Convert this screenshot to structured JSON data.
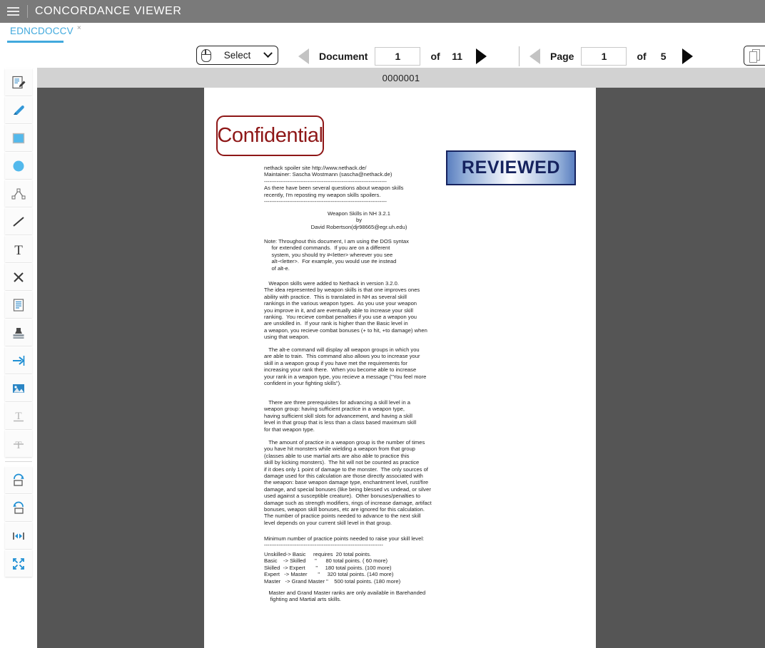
{
  "header": {
    "title": "CONCORDANCE VIEWER",
    "menu_icon": "hamburger-icon"
  },
  "tabs": [
    {
      "label": "EDNCDOCCV",
      "close": "×",
      "active": true
    }
  ],
  "toolbar": {
    "select_tool": {
      "label": "Select",
      "icon": "mouse-icon",
      "chevron": "chevron-down-icon"
    },
    "document_nav": {
      "label": "Document",
      "value": "1",
      "of": "of",
      "total": "11",
      "prev_icon": "triangle-left-icon",
      "next_icon": "triangle-right-icon"
    },
    "page_nav": {
      "label": "Page",
      "value": "1",
      "of": "of",
      "total": "5",
      "prev_icon": "triangle-left-icon",
      "next_icon": "triangle-right-icon"
    },
    "page_view_button": {
      "icon": "pages-icon"
    }
  },
  "tool_rail": {
    "items": [
      {
        "name": "note-annotation-tool",
        "icon": "note-edit-icon"
      },
      {
        "name": "highlighter-tool",
        "icon": "highlighter-icon"
      },
      {
        "name": "rectangle-tool",
        "icon": "rectangle-icon"
      },
      {
        "name": "ellipse-tool",
        "icon": "ellipse-icon"
      },
      {
        "name": "polyline-tool",
        "icon": "polyline-icon"
      },
      {
        "name": "line-tool",
        "icon": "line-icon"
      },
      {
        "name": "text-box-tool",
        "icon": "text-t-icon"
      },
      {
        "name": "cross-out-tool",
        "icon": "x-cross-icon"
      },
      {
        "name": "text-select-tool",
        "icon": "document-lines-icon"
      },
      {
        "name": "stamp-tool",
        "icon": "stamp-icon"
      },
      {
        "name": "arrow-tool",
        "icon": "arrow-right-icon"
      },
      {
        "name": "image-tool",
        "icon": "image-icon"
      },
      {
        "name": "underline-text-tool",
        "icon": "text-underline-icon"
      },
      {
        "name": "strikethrough-text-tool",
        "icon": "text-strikethrough-icon"
      },
      {
        "name": "rotate-clockwise",
        "icon": "rotate-cw-icon"
      },
      {
        "name": "rotate-counterclockwise",
        "icon": "rotate-ccw-icon"
      },
      {
        "name": "fit-width",
        "icon": "fit-width-icon"
      },
      {
        "name": "fit-page",
        "icon": "expand-icon"
      }
    ]
  },
  "viewer": {
    "page_label": "0000001",
    "stamps": [
      {
        "name": "confidential-stamp",
        "text": "Confidential",
        "color": "#8e1717"
      },
      {
        "name": "reviewed-stamp",
        "text": "REVIEWED",
        "color": "#15225e"
      }
    ],
    "document": {
      "header": "nethack spoiler site http://www.nethack.de/\nMaintainer: Sascha Wostmann (sascha@nethack.de)\n--------------------------------------------------------------------\nAs there have been several questions about weapon skills\nrecently, I'm reposting my weapon skills spoilers.\n--------------------------------------------------------------------",
      "title": "Weapon Skills in NH 3.2.1\nby\nDavid Robertson(djr98665@egr.uh.edu)",
      "note": "Note: Throughout this document, I am using the DOS syntax\n     for extended commands.  If you are on a different\n     system, you should try #<letter> wherever you see\n     alt-<letter>.  For example, you would use #e instead\n     of alt-e.",
      "paragraph_1": "   Weapon skills were added to Nethack in version 3.2.0.\nThe idea represented by weapon skills is that one improves ones\nability with practice.  This is translated in NH as several skill\nrankings in the various weapon types.  As you use your weapon\nyou improve in it, and are eventually able to increase your skill\nranking.  You recieve combat penalties if you use a weapon you\nare unskilled in.  If your rank is higher than the Basic level in\na weapon, you recieve combat bonuses (+ to hit, +to damage) when\nusing that weapon.",
      "paragraph_2": "   The alt-e command will display all weapon groups in which you\nare able to train.  This command also allows you to increase your\nskill in a weapon group if you have met the requirements for\nincreasing your rank there.  When you become able to increase\nyour rank in a weapon type, you recieve a message (\"You feel more\nconfident in your fighting skills\").",
      "paragraph_3": "   There are three prerequisites for advancing a skill level in a\nweapon group: having sufficient practice in a weapon type,\nhaving sufficient skill slots for advancement, and having a skill\nlevel in that group that is less than a class based maximum skill\nfor that weapon type.",
      "paragraph_4": "   The amount of practice in a weapon group is the number of times\nyou have hit monsters while wielding a weapon from that group\n(classes able to use martial arts are also able to practice this\nskill by kicking monsters).  The hit will not be counted as practice\nif it does only 1 point of damage to the monster.  The only sources of\ndamage used for this calculation are those directly associated with\nthe weapon: base weapon damage type, enchantment level, rust/fire\ndamage, and special bonuses (like being blessed vs undead, or silver\nused against a susceptible creature).  Other bonuses/penalties to\ndamage such as strength modifiers, rings of increase damage, artifact\nbonuses, weapon skill bonuses, etc are ignored for this calculation.\nThe number of practice points needed to advance to the next skill\nlevel depends on your current skill level in that group.",
      "paragraph_5": "Minimum number of practice points needed to raise your skill level:\n------------------------------------------------------------------",
      "skill_table": "Unskilled-> Basic     requires  20 total points.\nBasic    -> Skilled      \"      80 total points. ( 60 more)\nSkilled  -> Expert       \"     180 total points. (100 more)\nExpert   -> Master       \"     320 total points. (140 more)\nMaster   -> Grand Master \"    500 total points. (180 more)",
      "paragraph_6": "   Master and Grand Master ranks are only available in Barehanded\n    fighting and Martial arts skills."
    }
  },
  "colors": {
    "header_bg": "#7a7a7a",
    "accent": "#41a9dd",
    "viewer_bg": "#555555",
    "page_label_bg": "#d2d2d2"
  }
}
